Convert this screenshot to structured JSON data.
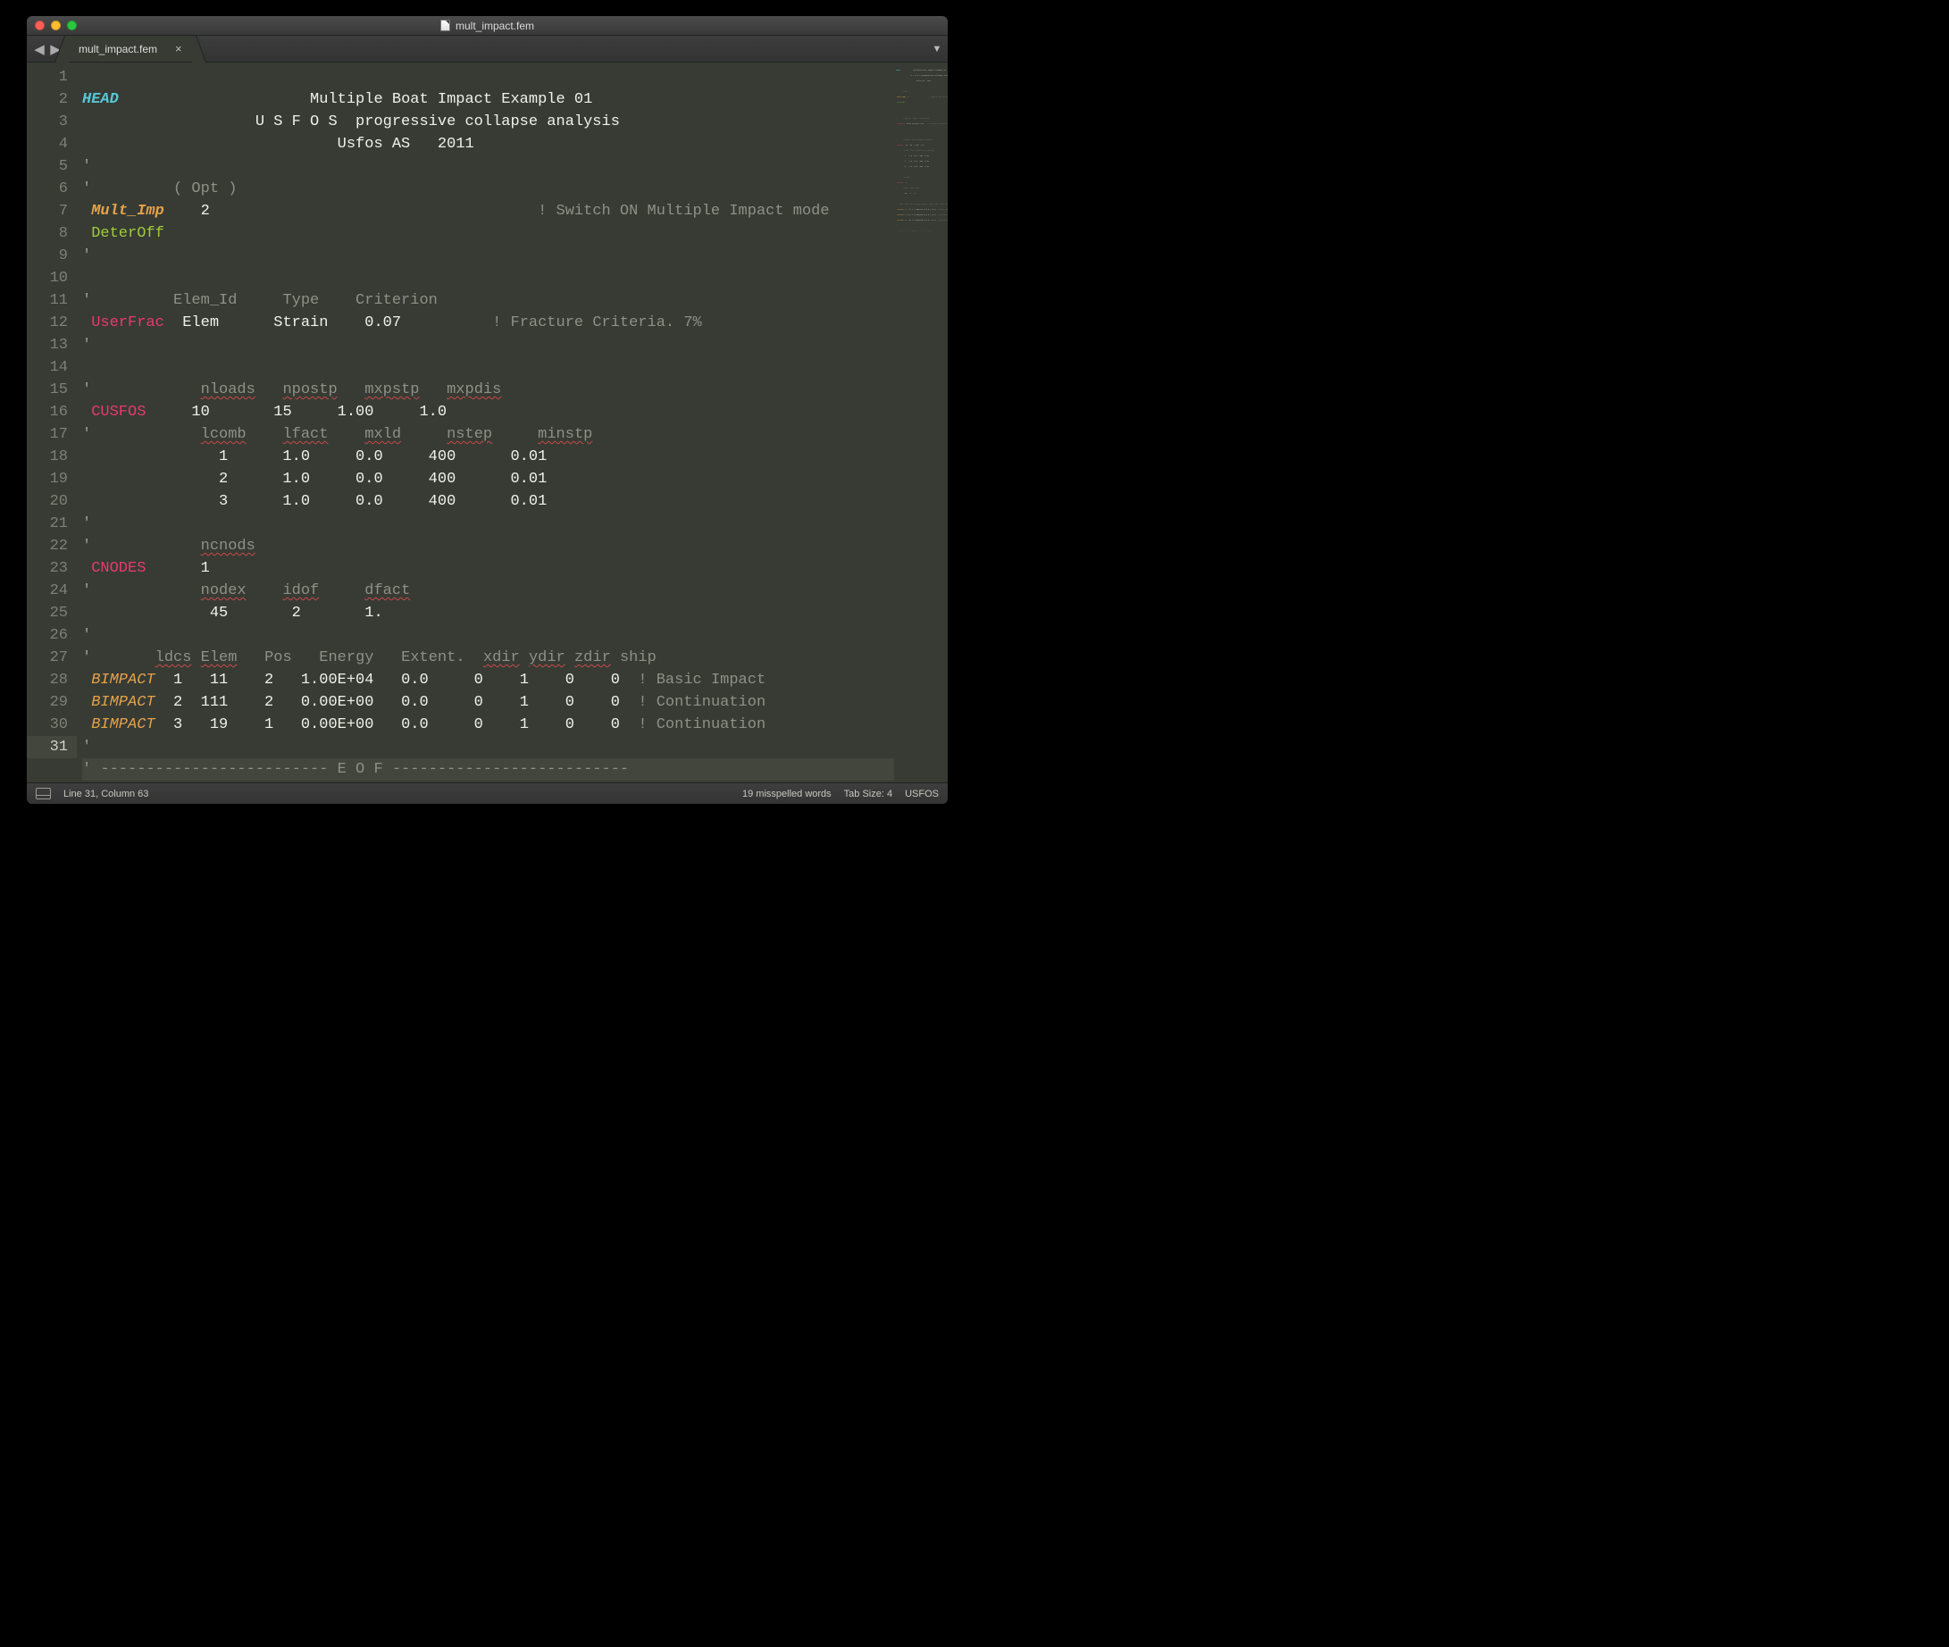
{
  "window": {
    "title": "mult_impact.fem"
  },
  "tabs": {
    "active": "mult_impact.fem",
    "close_glyph": "×"
  },
  "nav": {
    "back_glyph": "◀",
    "fwd_glyph": "▶",
    "dropdown_glyph": "▼"
  },
  "lines": {
    "1": {
      "head": "HEAD",
      "rest": "                     Multiple Boat Impact Example 01"
    },
    "2": {
      "rest": "                   U S F O S  progressive collapse analysis"
    },
    "3": {
      "rest": "                            Usfos AS   2011"
    },
    "4": {
      "q": "'"
    },
    "5": {
      "q": "'",
      "c": "         ( Opt )"
    },
    "6": {
      "kw": " Mult_Imp",
      "vals": "    2",
      "cmt": "                                    ! Switch ON Multiple Impact mode"
    },
    "7": {
      "kw2": " DeterOff"
    },
    "8": {
      "q": "'"
    },
    "10": {
      "q": "'",
      "c": "         Elem_Id     Type    Criterion"
    },
    "11": {
      "kw": " UserFrac",
      "vals": "  Elem      Strain    0.07",
      "cmt": "          ! Fracture Criteria. 7%"
    },
    "12": {
      "q": "'"
    },
    "14": {
      "q": "'",
      "hdr": [
        "            ",
        "nloads",
        "   ",
        "npostp",
        "   ",
        "mxpstp",
        "   ",
        "mxpdis"
      ]
    },
    "15": {
      "kw": " CUSFOS",
      "vals": "     10       15     1.00     1.0"
    },
    "16": {
      "q": "'",
      "hdr": [
        "            ",
        "lcomb",
        "    ",
        "lfact",
        "    ",
        "mxld",
        "     ",
        "nstep",
        "     ",
        "minstp"
      ]
    },
    "17": {
      "vals": "               1      1.0     0.0     400      0.01"
    },
    "18": {
      "vals": "               2      1.0     0.0     400      0.01"
    },
    "19": {
      "vals": "               3      1.0     0.0     400      0.01"
    },
    "20": {
      "q": "'"
    },
    "21": {
      "q": "'",
      "hdr": [
        "            ",
        "ncnods"
      ]
    },
    "22": {
      "kw": " CNODES",
      "vals": "      1"
    },
    "23": {
      "q": "'",
      "hdr": [
        "            ",
        "nodex",
        "    ",
        "idof",
        "     ",
        "dfact"
      ]
    },
    "24": {
      "vals": "              45       2       1."
    },
    "25": {
      "q": "'"
    },
    "26": {
      "q": "'",
      "hdr": [
        "       ",
        "ldcs",
        " ",
        "Elem",
        "   ",
        "Pos",
        "   ",
        "Energy",
        "   ",
        "Extent.",
        "  ",
        "xdir",
        " ",
        "ydir",
        " ",
        "zdir",
        " ",
        "ship"
      ]
    },
    "27": {
      "kw": " BIMPACT",
      "vals": "  1   11    2   1.00E+04   0.0     0    1    0    0",
      "cmt": "  ! Basic Impact"
    },
    "28": {
      "kw": " BIMPACT",
      "vals": "  2  111    2   0.00E+00   0.0     0    1    0    0",
      "cmt": "  ! Continuation"
    },
    "29": {
      "kw": " BIMPACT",
      "vals": "  3   19    1   0.00E+00   0.0     0    1    0    0",
      "cmt": "  ! Continuation"
    },
    "30": {
      "q": "'"
    },
    "31": {
      "eof": "' ------------------------- E O F --------------------------"
    }
  },
  "status": {
    "pos": "Line 31, Column 63",
    "spell": "19 misspelled words",
    "tabsize": "Tab Size: 4",
    "syntax": "USFOS"
  }
}
